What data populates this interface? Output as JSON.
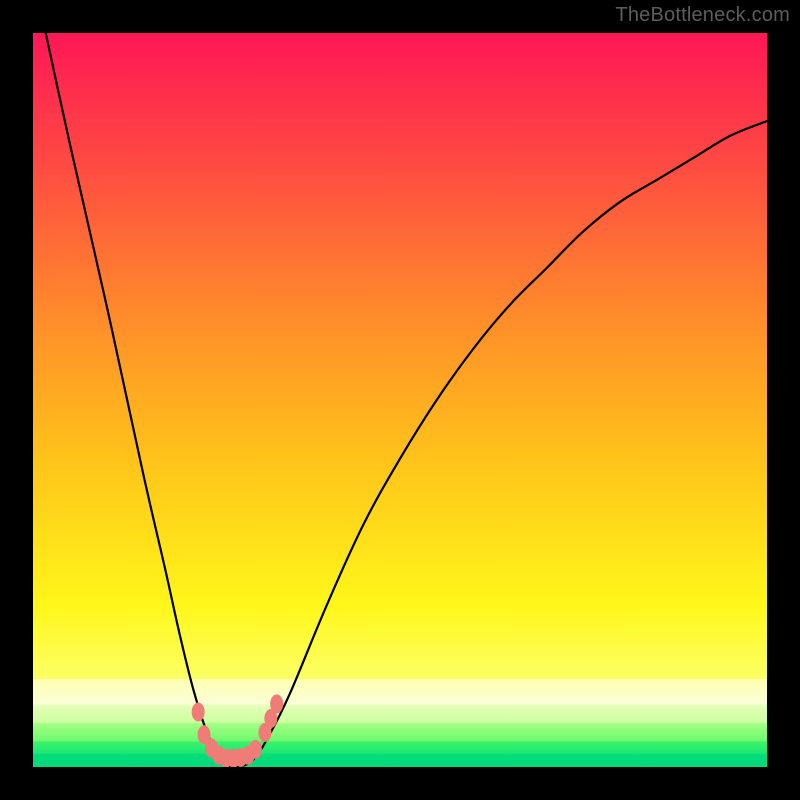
{
  "watermark": "TheBottleneck.com",
  "colors": {
    "black": "#000000",
    "curve": "#000000",
    "dot_fill": "#ef7c76",
    "dot_stroke": "#c85a54"
  },
  "chart_data": {
    "type": "line",
    "title": "",
    "xlabel": "",
    "ylabel": "",
    "xlim": [
      0,
      100
    ],
    "ylim": [
      0,
      100
    ],
    "grid": false,
    "legend": false,
    "series": [
      {
        "name": "bottleneck-curve",
        "x": [
          0,
          5,
          10,
          15,
          18,
          20,
          22,
          24,
          26,
          27,
          28,
          30,
          32,
          35,
          40,
          45,
          50,
          55,
          60,
          65,
          70,
          75,
          80,
          85,
          90,
          95,
          100
        ],
        "y": [
          108,
          85,
          63,
          40,
          27,
          18,
          10,
          4,
          1,
          0,
          0,
          1,
          4,
          10,
          22,
          33,
          42,
          50,
          57,
          63,
          68,
          73,
          77,
          80,
          83,
          86,
          88
        ]
      }
    ],
    "highlight_dots": [
      {
        "x": 22.5,
        "y": 7.5
      },
      {
        "x": 23.3,
        "y": 4.4
      },
      {
        "x": 24.3,
        "y": 2.6
      },
      {
        "x": 25.3,
        "y": 1.6
      },
      {
        "x": 26.3,
        "y": 1.2
      },
      {
        "x": 27.3,
        "y": 1.2
      },
      {
        "x": 28.3,
        "y": 1.3
      },
      {
        "x": 29.3,
        "y": 1.6
      },
      {
        "x": 30.3,
        "y": 2.4
      },
      {
        "x": 31.6,
        "y": 4.7
      },
      {
        "x": 32.4,
        "y": 6.6
      },
      {
        "x": 33.2,
        "y": 8.6
      }
    ],
    "gradient_bands": [
      {
        "y0": 100,
        "y1": 82,
        "from": "#ff1756",
        "to": "#ff4b42"
      },
      {
        "y0": 82,
        "y1": 62,
        "from": "#ff4b42",
        "to": "#ff8a2b"
      },
      {
        "y0": 62,
        "y1": 42,
        "from": "#ff8a2b",
        "to": "#ffc31a"
      },
      {
        "y0": 42,
        "y1": 22,
        "from": "#ffc31a",
        "to": "#fff71a"
      },
      {
        "y0": 22,
        "y1": 12,
        "from": "#fff71a",
        "to": "#fcff66"
      },
      {
        "y0": 12,
        "y1": 8.5,
        "from": "#fcffb0",
        "to": "#fbffd8"
      },
      {
        "y0": 8.5,
        "y1": 6,
        "from": "#e7ffba",
        "to": "#c9ff9e"
      },
      {
        "y0": 6,
        "y1": 3.5,
        "from": "#a6ff85",
        "to": "#6cf96e"
      },
      {
        "y0": 3.5,
        "y1": 1.8,
        "from": "#3df26a",
        "to": "#18e774"
      },
      {
        "y0": 1.8,
        "y1": 0,
        "from": "#05dd7a",
        "to": "#02d97c"
      }
    ]
  }
}
